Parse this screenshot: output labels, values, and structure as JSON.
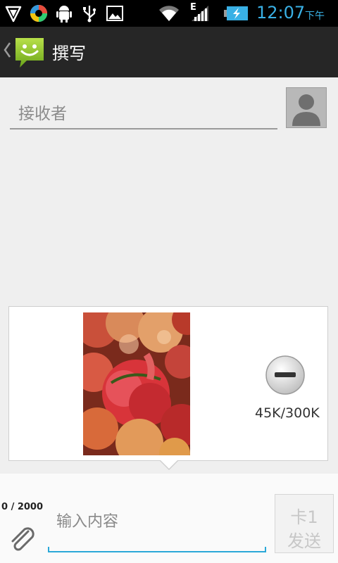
{
  "status_bar": {
    "time": "12:07",
    "ampm": "下午",
    "network_type": "E",
    "icons": [
      "shield-icon",
      "app-icon",
      "android-icon",
      "usb-icon",
      "image-icon",
      "wifi-icon",
      "signal-icon",
      "battery-charging-icon"
    ]
  },
  "action_bar": {
    "title": "撰写",
    "app_icon": "messaging-smiley-icon"
  },
  "recipient": {
    "placeholder": "接收者"
  },
  "attachment": {
    "size_text": "45K/300K",
    "image_icon": "tomatoes-photo"
  },
  "compose": {
    "char_count": "0 / 2000",
    "placeholder": "输入内容",
    "send_sim": "卡1",
    "send_label": "发送"
  },
  "colors": {
    "accent": "#39b0e5",
    "input_underline": "#2aa8d8",
    "action_bar_bg": "#262626"
  }
}
